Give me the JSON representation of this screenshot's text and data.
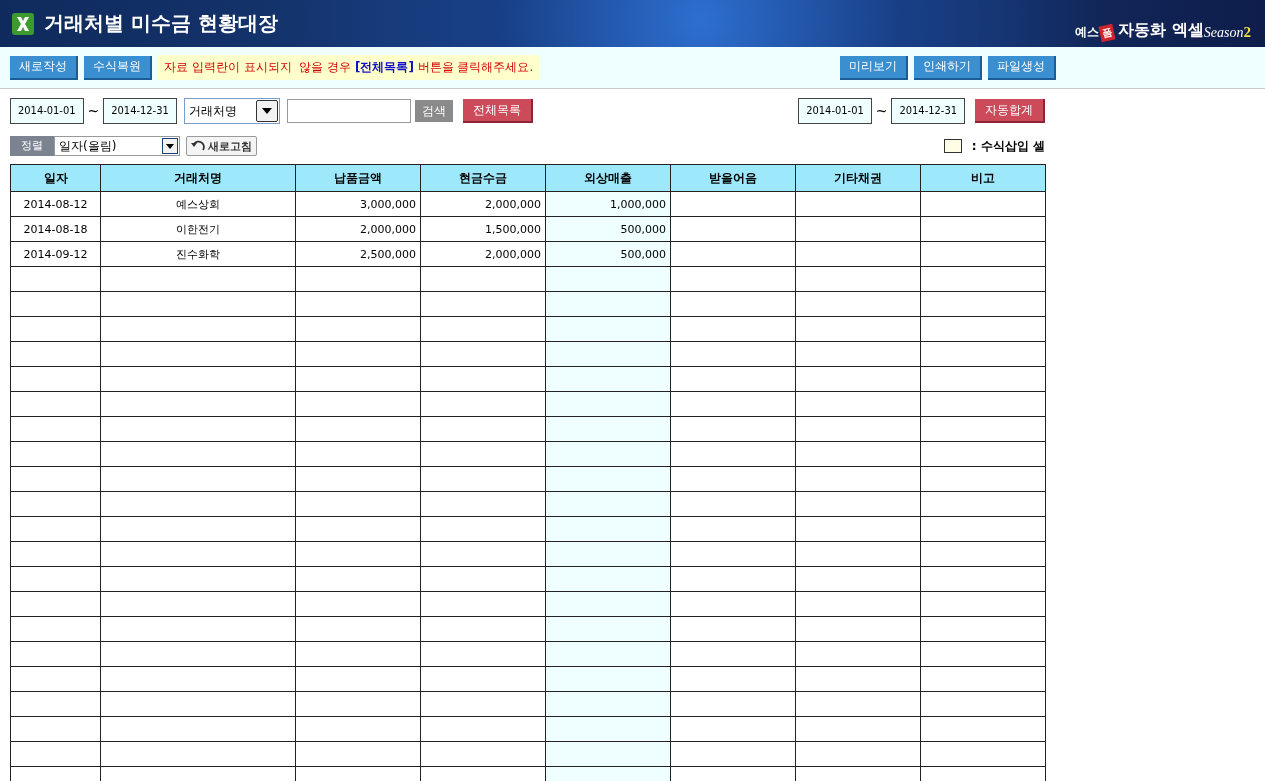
{
  "window": {
    "title": "거래처별 미수금 현황대장"
  },
  "brand": {
    "prefix": "예스",
    "tag": "폼",
    "name": "자동화 엑셀",
    "season": "Season",
    "number": "2"
  },
  "toolbar": {
    "left_buttons": [
      "새로작성",
      "수식복원"
    ],
    "notice": "자료 입력란이 표시되지  않을 경우 **[전체목록]** 버튼을 클릭해주세요.",
    "right_buttons": [
      "미리보기",
      "인쇄하기",
      "파일생성"
    ]
  },
  "filter": {
    "date_from": "2014-01-01",
    "tilde": "~",
    "date_to": "2014-12-31",
    "field_select": "거래처명",
    "search_button": "검색",
    "all_button": "전체목록"
  },
  "summary": {
    "date_from": "2014-01-01",
    "tilde": "~",
    "date_to": "2014-12-31",
    "button": "자동합계"
  },
  "sort": {
    "label": "정렬",
    "value": "일자(올림)",
    "refresh_button": "새로고침"
  },
  "legend": {
    "label": ": 수식삽입 셀"
  },
  "table": {
    "columns": [
      "일자",
      "거래처명",
      "납품금액",
      "현금수금",
      "외상매출",
      "받을어음",
      "기타채권",
      "비고"
    ],
    "rows": [
      {
        "date": "2014-08-12",
        "client": "예스상회",
        "delivery": "3,000,000",
        "cash": "2,000,000",
        "credit": "1,000,000"
      },
      {
        "date": "2014-08-18",
        "client": "이한전기",
        "delivery": "2,000,000",
        "cash": "1,500,000",
        "credit": "500,000"
      },
      {
        "date": "2014-09-12",
        "client": "진수화학",
        "delivery": "2,500,000",
        "cash": "2,000,000",
        "credit": "500,000"
      }
    ]
  }
}
